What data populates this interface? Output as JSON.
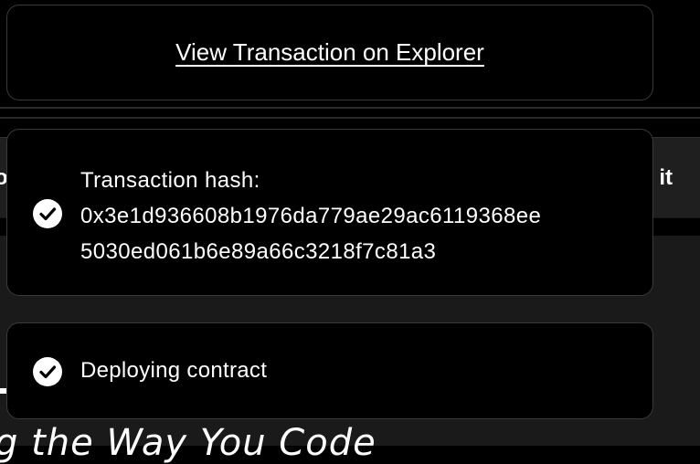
{
  "background": {
    "bar_left_fragment": "o",
    "bar_right_fragment": "it",
    "hero_text_fragment": "g the Way You Code"
  },
  "toasts": {
    "explorer": {
      "link_label": "View Transaction on Explorer"
    },
    "transaction": {
      "heading": "Transaction hash:",
      "hash_line_1": "0x3e1d936608b1976da779ae29ac6119368ee",
      "hash_line_2": "5030ed061b6e89a66c3218f7c81a3",
      "icon": "check-circle-icon"
    },
    "deploy": {
      "status_text": "Deploying contract",
      "icon": "check-circle-icon"
    }
  },
  "colors": {
    "toast_background": "#000000",
    "toast_border": "#3a3a3a",
    "text": "#ffffff",
    "page_bar": "#1f1f1f",
    "page_panel": "#1a1a1a"
  }
}
